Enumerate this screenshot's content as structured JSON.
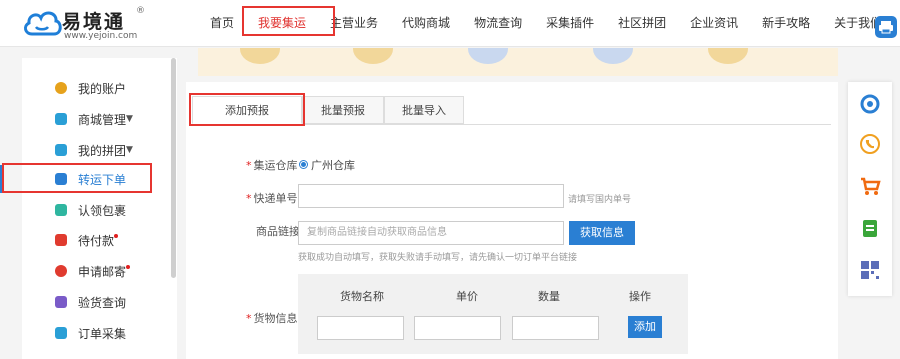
{
  "brand": {
    "name": "易境通",
    "reg": "®",
    "url": "www.yejoin.com",
    "color": "#1f7fd8"
  },
  "nav": [
    {
      "label": "首页",
      "active": false
    },
    {
      "label": "我要集运",
      "active": true
    },
    {
      "label": "主营业务",
      "active": false
    },
    {
      "label": "代购商城",
      "active": false
    },
    {
      "label": "物流查询",
      "active": false
    },
    {
      "label": "采集插件",
      "active": false
    },
    {
      "label": "社区拼团",
      "active": false
    },
    {
      "label": "企业资讯",
      "active": false
    },
    {
      "label": "新手攻略",
      "active": false
    },
    {
      "label": "关于我们",
      "active": false
    }
  ],
  "sidebar": {
    "items": [
      {
        "label": "我的账户",
        "icon": "user-icon",
        "color": "#e6a21c"
      },
      {
        "label": "商城管理",
        "icon": "shop-icon",
        "color": "#2a9fd6",
        "caret": "▼"
      },
      {
        "label": "我的拼团",
        "icon": "group-icon",
        "color": "#2a9fd6",
        "caret": "▼"
      },
      {
        "label": "转运下单",
        "icon": "order-icon",
        "color": "#2a7fd3"
      },
      {
        "label": "认领包裹",
        "icon": "package-icon",
        "color": "#2fb6a0"
      },
      {
        "label": "待付款",
        "icon": "payment-icon",
        "color": "#e03b2f",
        "badge": true
      },
      {
        "label": "申请邮寄",
        "icon": "mail-icon",
        "color": "#e03b2f",
        "badge": true
      },
      {
        "label": "验货查询",
        "icon": "inspect-icon",
        "color": "#7a5bc8"
      },
      {
        "label": "订单采集",
        "icon": "collect-icon",
        "color": "#2a9fd6"
      }
    ]
  },
  "tabs": [
    {
      "label": "添加预报",
      "active": true
    },
    {
      "label": "批量预报",
      "active": false
    },
    {
      "label": "批量导入",
      "active": false
    }
  ],
  "form": {
    "required_mark": "*",
    "warehouse_label": "集运仓库",
    "warehouse_option": "广州仓库",
    "tracking_label": "快递单号",
    "tracking_hint": "请填写国内单号",
    "link_label": "商品链接",
    "link_placeholder": "复制商品链接自动获取商品信息",
    "fetch_button": "获取信息",
    "link_hint": "获取成功自动填写，获取失败请手动填写，请先确认一切订单平台链接",
    "goods_label": "货物信息",
    "table_headers": [
      "货物名称",
      "单价",
      "数量",
      "操作"
    ],
    "add_button": "添加"
  },
  "float_toolbar": [
    {
      "icon": "customer-service-icon",
      "color": "#2a7fd3"
    },
    {
      "icon": "phone-icon",
      "color": "#f0a020"
    },
    {
      "icon": "cart-icon",
      "color": "#f06a10"
    },
    {
      "icon": "clipboard-icon",
      "color": "#3aa63a"
    },
    {
      "icon": "qr-code-icon",
      "color": "#5b6db8"
    }
  ]
}
